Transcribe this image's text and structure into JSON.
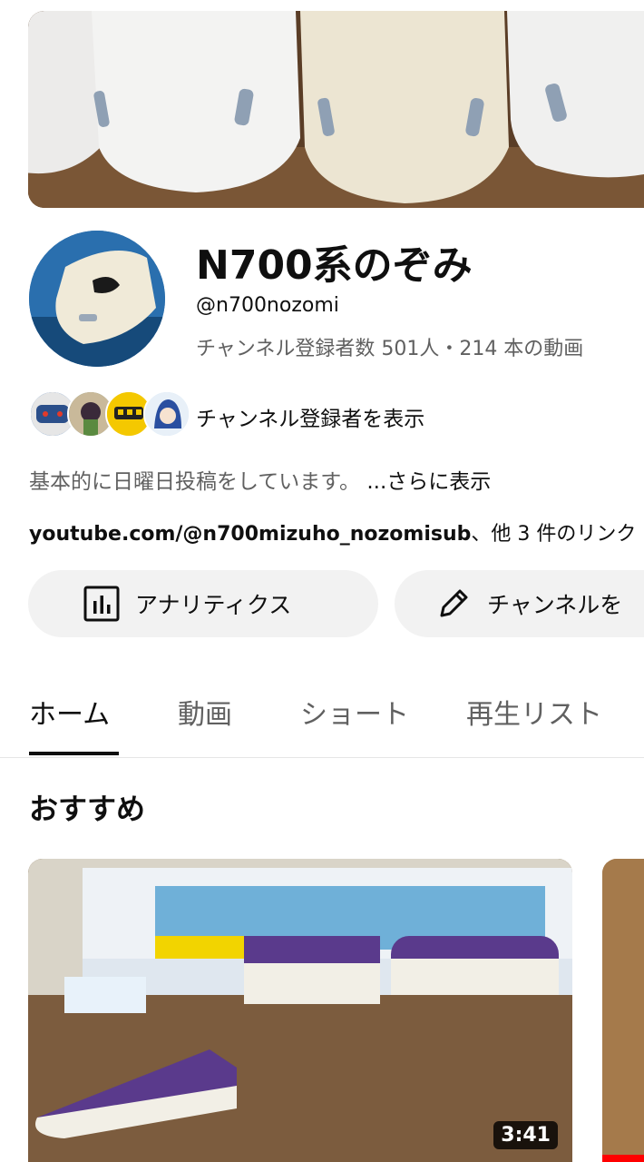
{
  "channel": {
    "name": "N700系のぞみ",
    "handle": "@n700nozomi",
    "stats": "チャンネル登録者数 501人・214 本の動画",
    "subscribers_label": "チャンネル登録者を表示",
    "description": "基本的に日曜日投稿をしています。",
    "description_more": "...さらに表示",
    "link_url": "youtube.com/@n700mizuho_nozomisub",
    "link_more": "、他 3 件のリンク"
  },
  "buttons": {
    "analytics_label": "アナリティクス",
    "edit_label": "チャンネルを"
  },
  "tabs": [
    "ホーム",
    "動画",
    "ショート",
    "再生リスト"
  ],
  "section": {
    "title": "おすすめ"
  },
  "video": {
    "duration": "3:41"
  },
  "icons": {
    "analytics": "bar-chart-icon",
    "edit": "pencil-icon"
  },
  "colors": {
    "text_primary": "#0f0f0f",
    "text_secondary": "#606060",
    "button_bg": "#f2f2f2"
  }
}
